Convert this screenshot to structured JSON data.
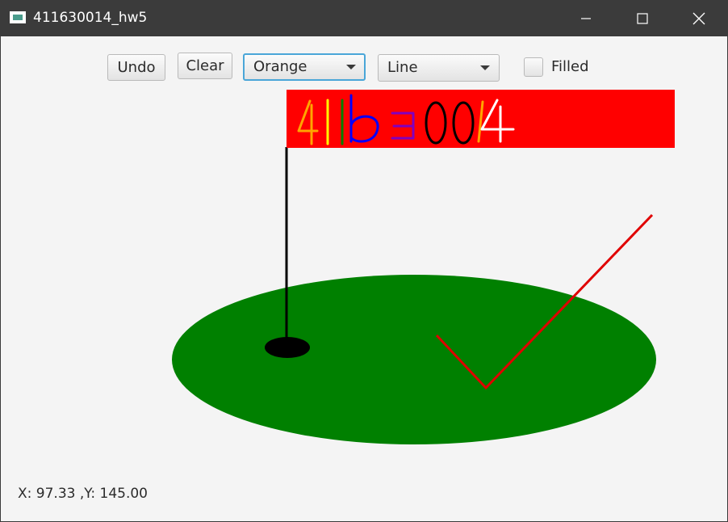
{
  "window": {
    "title": "411630014_hw5"
  },
  "toolbar": {
    "undo_label": "Undo",
    "clear_label": "Clear",
    "color_select_value": "Orange",
    "shape_select_value": "Line",
    "filled_label": "Filled",
    "filled_checked": false
  },
  "drawing": {
    "shapes": [
      "filled-oval",
      "filled-oval",
      "line",
      "filled-rectangle",
      "line",
      "line"
    ],
    "colors": {
      "green": "#008000",
      "black": "#000000",
      "red": "#ff0000",
      "orange": "#ffa500",
      "yellow": "#ffff00",
      "blue": "#0000ff",
      "purple": "#8000c0",
      "white": "#ffffff"
    }
  },
  "status": {
    "coordinates": "X: 97.33 ,Y: 145.00"
  }
}
